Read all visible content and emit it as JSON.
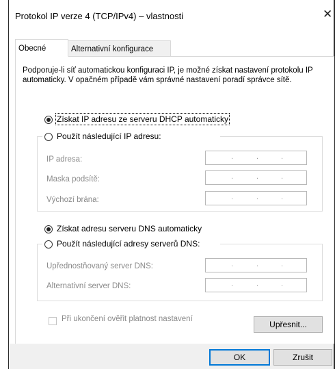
{
  "window": {
    "title": "Protokol IP verze 4 (TCP/IPv4) – vlastnosti",
    "close_glyph": "✕"
  },
  "tabs": [
    {
      "label": "Obecné",
      "active": true
    },
    {
      "label": "Alternativní konfigurace",
      "active": false
    }
  ],
  "description": "Podporuje-li síť automatickou konfiguraci IP, je možné získat nastavení protokolu IP automaticky. V opačném případě vám správné nastavení poradí správce sítě.",
  "ip_section": {
    "auto_option": "Získat IP adresu ze serveru DHCP automaticky",
    "manual_option": "Použít následující IP adresu:",
    "selected": "auto",
    "fields": [
      {
        "label": "IP adresa:",
        "value": ""
      },
      {
        "label": "Maska podsítě:",
        "value": ""
      },
      {
        "label": "Výchozí brána:",
        "value": ""
      }
    ]
  },
  "dns_section": {
    "auto_option": "Získat adresu serveru DNS automaticky",
    "manual_option": "Použít následující adresy serverů DNS:",
    "selected": "auto",
    "fields": [
      {
        "label": "Upřednostňovaný server DNS:",
        "value": ""
      },
      {
        "label": "Alternativní server DNS:",
        "value": ""
      }
    ]
  },
  "validate_checkbox": {
    "label": "Při ukončení ověřit platnost nastavení",
    "checked": false,
    "enabled": false
  },
  "buttons": {
    "advanced": "Upřesnit...",
    "ok": "OK",
    "cancel": "Zrušit"
  },
  "ip_dots": "."
}
